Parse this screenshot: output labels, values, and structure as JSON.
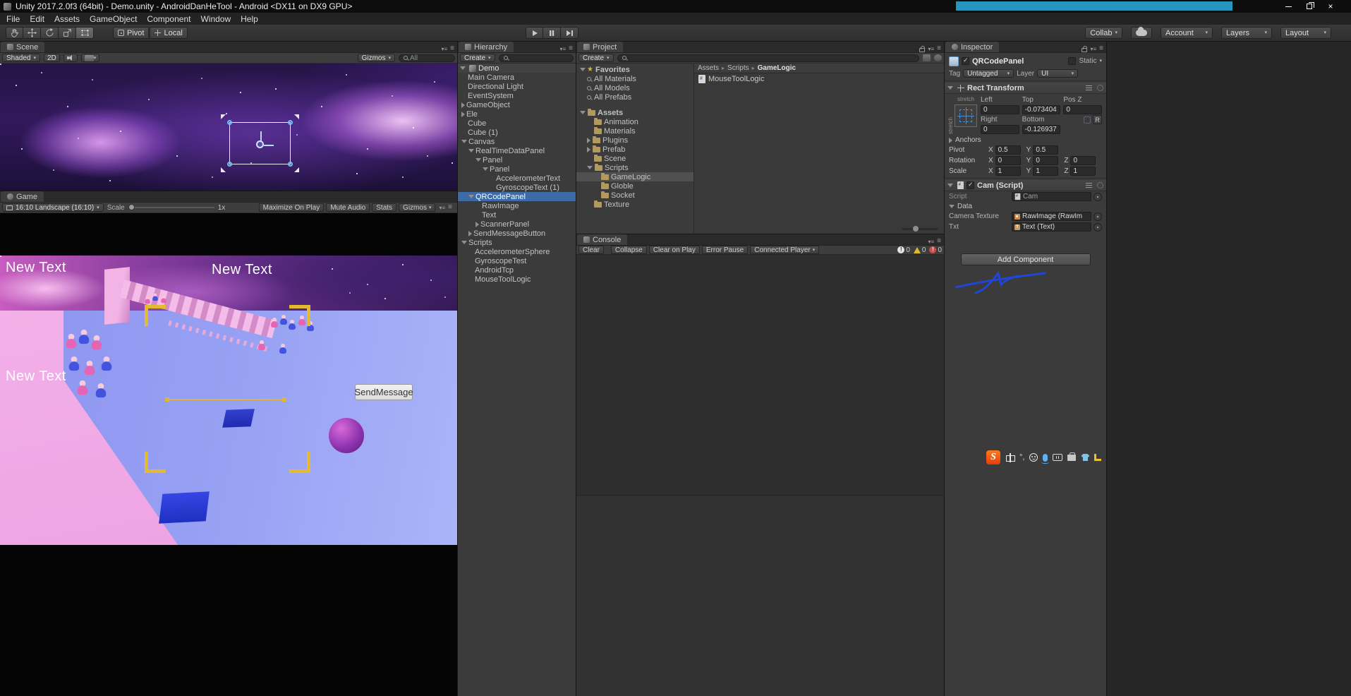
{
  "titlebar": {
    "title": "Unity 2017.2.0f3 (64bit) - Demo.unity - AndroidDanHeTool - Android <DX11 on DX9 GPU>"
  },
  "menubar": {
    "items": [
      "File",
      "Edit",
      "Assets",
      "GameObject",
      "Component",
      "Window",
      "Help"
    ]
  },
  "toolbar": {
    "pivot": "Pivot",
    "local": "Local",
    "collab": "Collab",
    "account": "Account",
    "layers": "Layers",
    "layout": "Layout"
  },
  "scene_view": {
    "tab": "Scene",
    "shaded": "Shaded",
    "mode2d": "2D",
    "gizmos": "Gizmos",
    "search": "All"
  },
  "game_view": {
    "tab": "Game",
    "aspect": "16:10 Landscape (16:10)",
    "scale_label": "Scale",
    "scale_value": "1x",
    "maximize_on_play": "Maximize On Play",
    "mute_audio": "Mute Audio",
    "stats": "Stats",
    "gizmos": "Gizmos",
    "overlay": {
      "text_top_left": "New Text",
      "text_top_center": "New Text",
      "text_mid_left": "New Text",
      "send_button": "SendMessage"
    }
  },
  "hierarchy": {
    "tab": "Hierarchy",
    "create": "Create",
    "scene_name": "Demo",
    "items": [
      {
        "label": "Main Camera",
        "indent": 0,
        "state": "leaf"
      },
      {
        "label": "Directional Light",
        "indent": 0,
        "state": "leaf"
      },
      {
        "label": "EventSystem",
        "indent": 0,
        "state": "leaf"
      },
      {
        "label": "GameObject",
        "indent": 0,
        "state": "collapsed"
      },
      {
        "label": "Ele",
        "indent": 0,
        "state": "collapsed"
      },
      {
        "label": "Cube",
        "indent": 0,
        "state": "leaf"
      },
      {
        "label": "Cube (1)",
        "indent": 0,
        "state": "leaf"
      },
      {
        "label": "Canvas",
        "indent": 0,
        "state": "expanded"
      },
      {
        "label": "RealTimeDataPanel",
        "indent": 1,
        "state": "expanded"
      },
      {
        "label": "Panel",
        "indent": 2,
        "state": "expanded"
      },
      {
        "label": "Panel",
        "indent": 3,
        "state": "expanded"
      },
      {
        "label": "AccelerometerText",
        "indent": 4,
        "state": "leaf"
      },
      {
        "label": "GyroscopeText (1)",
        "indent": 4,
        "state": "leaf"
      },
      {
        "label": "QRCodePanel",
        "indent": 1,
        "state": "expanded",
        "selected": true
      },
      {
        "label": "RawImage",
        "indent": 2,
        "state": "leaf"
      },
      {
        "label": "Text",
        "indent": 2,
        "state": "leaf"
      },
      {
        "label": "ScannerPanel",
        "indent": 2,
        "state": "collapsed"
      },
      {
        "label": "SendMessageButton",
        "indent": 1,
        "state": "collapsed"
      },
      {
        "label": "Scripts",
        "indent": 0,
        "state": "expanded"
      },
      {
        "label": "AccelerometerSphere",
        "indent": 1,
        "state": "leaf"
      },
      {
        "label": "GyroscopeTest",
        "indent": 1,
        "state": "leaf"
      },
      {
        "label": "AndroidTcp",
        "indent": 1,
        "state": "leaf"
      },
      {
        "label": "MouseToolLogic",
        "indent": 1,
        "state": "leaf"
      }
    ]
  },
  "project": {
    "tab": "Project",
    "create": "Create",
    "favorites_label": "Favorites",
    "favorites": [
      {
        "label": "All Materials"
      },
      {
        "label": "All Models"
      },
      {
        "label": "All Prefabs"
      }
    ],
    "assets_label": "Assets",
    "folders": [
      {
        "label": "Animation",
        "indent": 1,
        "state": "leaf"
      },
      {
        "label": "Materials",
        "indent": 1,
        "state": "leaf"
      },
      {
        "label": "Plugins",
        "indent": 1,
        "state": "collapsed"
      },
      {
        "label": "Prefab",
        "indent": 1,
        "state": "collapsed"
      },
      {
        "label": "Scene",
        "indent": 1,
        "state": "leaf"
      },
      {
        "label": "Scripts",
        "indent": 1,
        "state": "expanded"
      },
      {
        "label": "GameLogic",
        "indent": 2,
        "state": "leaf",
        "selected": true
      },
      {
        "label": "Globle",
        "indent": 2,
        "state": "leaf"
      },
      {
        "label": "Socket",
        "indent": 2,
        "state": "leaf"
      },
      {
        "label": "Texture",
        "indent": 1,
        "state": "leaf"
      }
    ],
    "breadcrumb": {
      "a": "Assets",
      "b": "Scripts",
      "c": "GameLogic"
    },
    "file": {
      "name": "MouseToolLogic"
    }
  },
  "console": {
    "tab": "Console",
    "clear": "Clear",
    "collapse": "Collapse",
    "clear_on_play": "Clear on Play",
    "error_pause": "Error Pause",
    "connected_player": "Connected Player",
    "info_count": "0",
    "warning_count": "0",
    "error_count": "0"
  },
  "inspector": {
    "tab": "Inspector",
    "name": "QRCodePanel",
    "static_label": "Static",
    "tag_label": "Tag",
    "tag_value": "Untagged",
    "layer_label": "Layer",
    "layer_value": "UI",
    "rect": {
      "title": "Rect Transform",
      "stretch_top": "stretch",
      "stretch_left": "stretch",
      "left_label": "Left",
      "left_value": "0",
      "top_label": "Top",
      "top_value": "-0.073404",
      "posz_label": "Pos Z",
      "posz_value": "0",
      "right_label": "Right",
      "right_value": "0",
      "bottom_label": "Bottom",
      "bottom_value": "-0.126937",
      "r_button": "R",
      "anchors": "Anchors",
      "pivot": "Pivot",
      "x": "X",
      "y": "Y",
      "z": "Z",
      "pivot_x": "0.5",
      "pivot_y": "0.5",
      "rotation": "Rotation",
      "rot_x": "0",
      "rot_y": "0",
      "rot_z": "0",
      "scale": "Scale",
      "scl_x": "1",
      "scl_y": "1",
      "scl_z": "1"
    },
    "cam": {
      "title": "Cam (Script)",
      "script_label": "Script",
      "script_value": "Cam",
      "data_label": "Data",
      "camera_texture_label": "Camera Texture",
      "camera_texture_value": "RawImage (RawIm",
      "txt_label": "Txt",
      "txt_value": "Text (Text)"
    },
    "add_component": "Add Component"
  },
  "ime": {
    "logo": "S"
  }
}
